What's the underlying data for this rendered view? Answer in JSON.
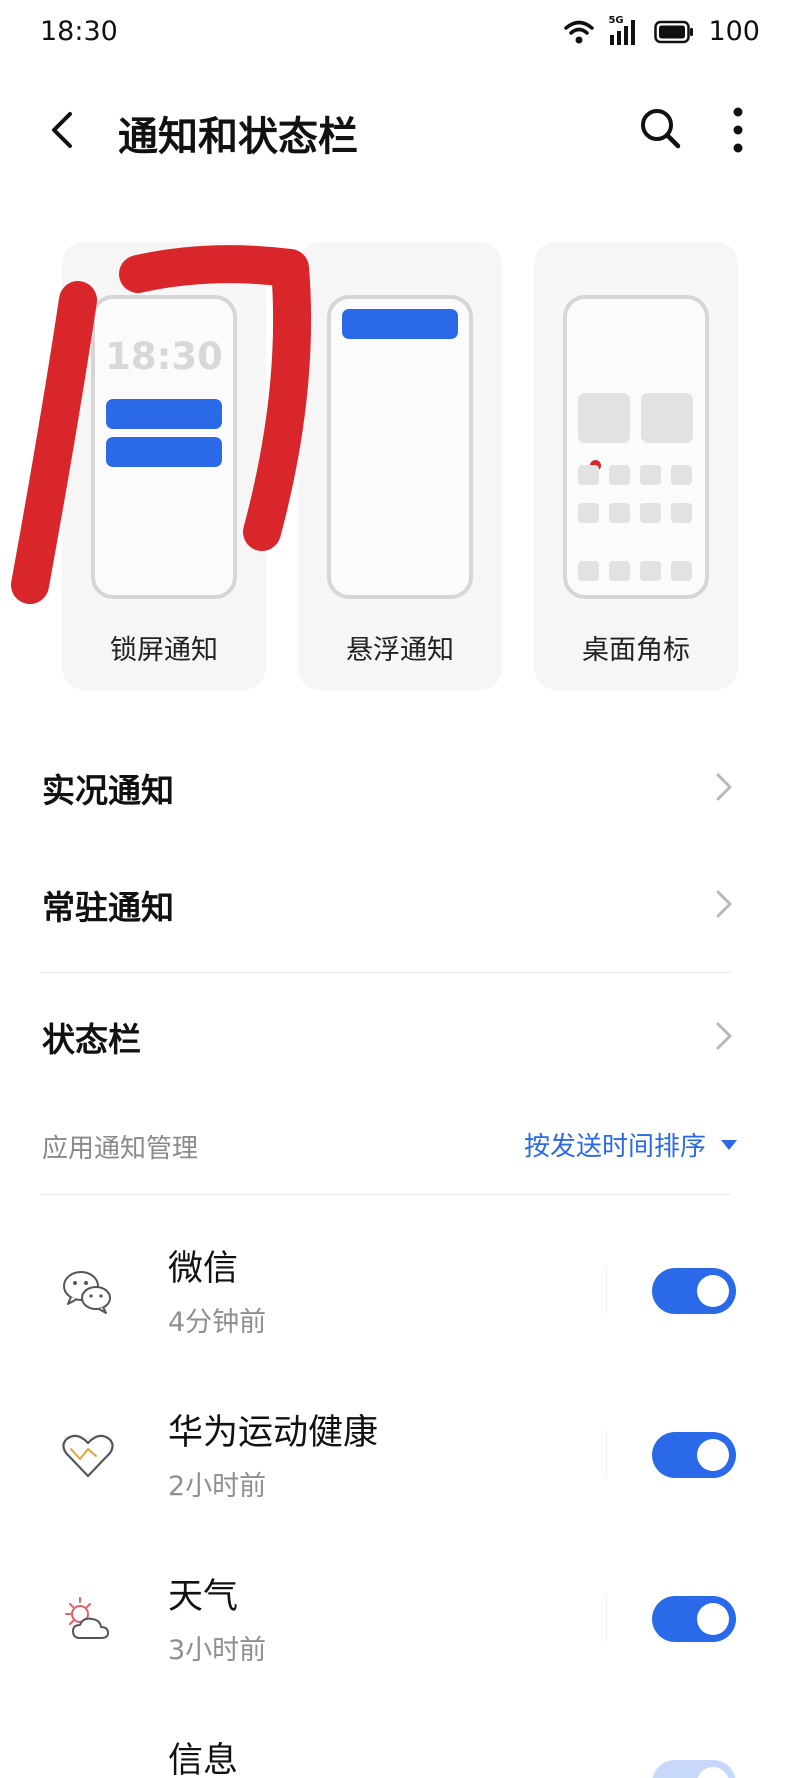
{
  "status_bar": {
    "time": "18:30",
    "network_label": "5G",
    "battery": "100",
    "icons": [
      "wifi-icon",
      "signal-icon",
      "battery-icon"
    ]
  },
  "header": {
    "title": "通知和状态栏",
    "icons": [
      "back-arrow-icon",
      "search-icon",
      "more-vertical-icon"
    ]
  },
  "notification_styles": [
    {
      "label": "锁屏通知",
      "preview_time": "18:30"
    },
    {
      "label": "悬浮通知"
    },
    {
      "label": "桌面角标"
    }
  ],
  "menu": [
    {
      "label": "实况通知"
    },
    {
      "label": "常驻通知"
    },
    {
      "label": "状态栏"
    }
  ],
  "app_section": {
    "title": "应用通知管理",
    "sort_label": "按发送时间排序"
  },
  "apps": [
    {
      "name": "微信",
      "time": "4分钟前",
      "enabled": true,
      "icon": "wechat-icon"
    },
    {
      "name": "华为运动健康",
      "time": "2小时前",
      "enabled": true,
      "icon": "health-heart-icon"
    },
    {
      "name": "天气",
      "time": "3小时前",
      "enabled": true,
      "icon": "weather-icon"
    },
    {
      "name": "信息",
      "time": "",
      "enabled": true,
      "icon": "message-icon"
    }
  ],
  "colors": {
    "accent": "#2a6ae8",
    "annotation": "#d9262b",
    "card_bg": "#f6f6f7"
  }
}
